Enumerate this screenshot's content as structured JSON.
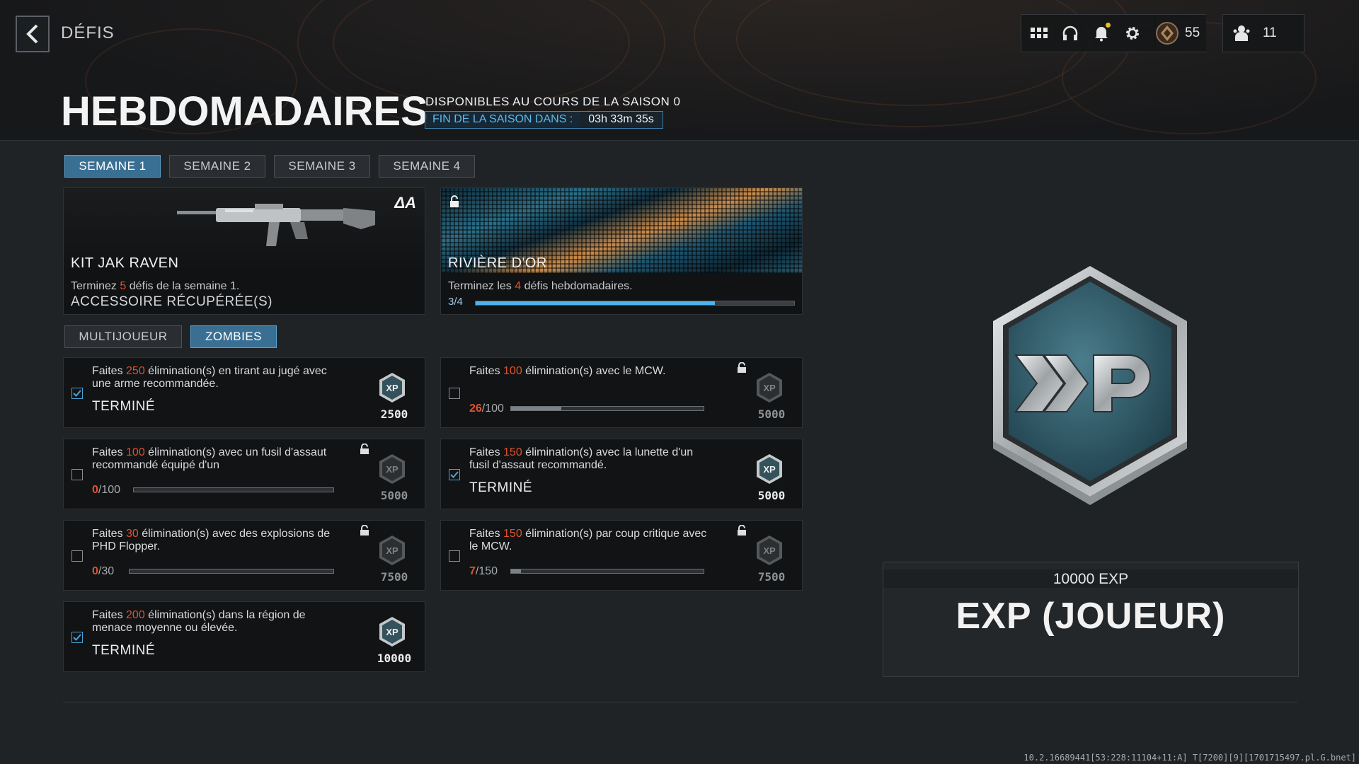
{
  "header": {
    "screen_label": "DÉFIS",
    "title": "HEBDOMADAIRES",
    "season_line": "DISPONIBLES AU COURS DE LA SAISON 0",
    "season_timer_label": "FIN DE LA SAISON DANS :",
    "season_timer_value": "03h 33m 35s",
    "rank_value": "55",
    "friends_value": "11",
    "icons": [
      "grid-icon",
      "headset-icon",
      "bell-icon",
      "gear-icon",
      "rank-emblem-icon",
      "friends-icon"
    ]
  },
  "week_tabs": [
    {
      "label": "SEMAINE 1",
      "active": true
    },
    {
      "label": "SEMAINE 2",
      "active": false
    },
    {
      "label": "SEMAINE 3",
      "active": false
    },
    {
      "label": "SEMAINE 4",
      "active": false
    }
  ],
  "rewards": {
    "left": {
      "name": "KIT JAK RAVEN",
      "desc_pre": "Terminez ",
      "desc_num": "5",
      "desc_post": " défis de la semaine 1.",
      "status": "ACCESSOIRE RÉCUPÉRÉE(S)",
      "brand": "ΔA"
    },
    "right": {
      "name": "RIVIÈRE D'OR",
      "desc_pre": "Terminez les ",
      "desc_num": "4",
      "desc_post": " défis hebdomadaires.",
      "progress_current": "3",
      "progress_total": "/4",
      "progress_fraction": 0.75
    }
  },
  "mode_tabs": [
    {
      "label": "MULTIJOUEUR",
      "active": false
    },
    {
      "label": "ZOMBIES",
      "active": true
    }
  ],
  "challenges": [
    {
      "pre": "Faites ",
      "num": "250",
      "post": " élimination(s) en tirant au jugé avec une arme recommandée.",
      "done": true,
      "done_label": "TERMINÉ",
      "reward": "2500",
      "locked": false
    },
    {
      "pre": "Faites ",
      "num": "100",
      "post": " élimination(s) avec le MCW.",
      "done": false,
      "current": "26",
      "total": "/100",
      "fraction": 0.26,
      "reward": "5000",
      "locked": true
    },
    {
      "pre": "Faites ",
      "num": "100",
      "post": " élimination(s) avec un fusil d'assaut recommandé équipé d'un",
      "done": false,
      "current": "0",
      "total": "/100",
      "fraction": 0.0,
      "reward": "5000",
      "locked": true
    },
    {
      "pre": "Faites ",
      "num": "150",
      "post": " élimination(s) avec la lunette d'un fusil d'assaut recommandé.",
      "done": true,
      "done_label": "TERMINÉ",
      "reward": "5000",
      "locked": false
    },
    {
      "pre": "Faites ",
      "num": "30",
      "post": " élimination(s) avec des explosions de PHD Flopper.",
      "done": false,
      "current": "0",
      "total": "/30",
      "fraction": 0.0,
      "reward": "7500",
      "locked": true
    },
    {
      "pre": "Faites ",
      "num": "150",
      "post": " élimination(s) par coup critique avec le MCW.",
      "done": false,
      "current": "7",
      "total": "/150",
      "fraction": 0.05,
      "reward": "7500",
      "locked": true
    },
    {
      "pre": "Faites ",
      "num": "200",
      "post": " élimination(s) dans la région de menace moyenne ou élevée.",
      "done": true,
      "done_label": "TERMINÉ",
      "reward": "10000",
      "locked": false
    }
  ],
  "reward_panel": {
    "amount": "10000 EXP",
    "name": "EXP (JOUEUR)"
  },
  "build_string": "10.2.16689441[53:228:11104+11:A] T[7200][9][1701715497.pl.G.bnet]",
  "colors": {
    "accent_blue": "#3a6f94",
    "progress_blue": "#4fb3ec",
    "highlight_red": "#e0522e"
  }
}
